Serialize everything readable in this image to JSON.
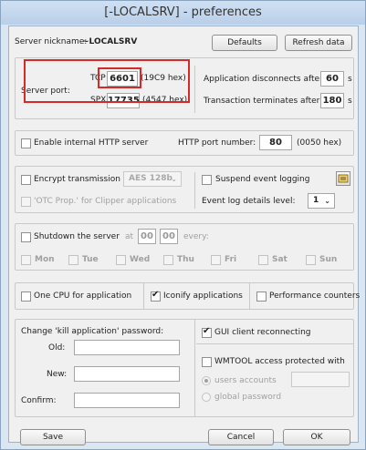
{
  "window": {
    "title": "[-LOCALSRV] - preferences"
  },
  "server": {
    "nickname_label": "Server nickname:",
    "nickname_value": "~LOCALSRV",
    "defaults_btn": "Defaults",
    "refresh_btn": "Refresh data",
    "port_label": "Server port:",
    "tcp_label": "TCP",
    "tcp_value": "6601",
    "tcp_hex": "(19C9 hex)",
    "spx_label": "SPX",
    "spx_value": "17735",
    "spx_hex": "(4547 hex)",
    "app_disc_label": "Application disconnects after",
    "app_disc_value": "60",
    "app_disc_unit": "s",
    "trans_label": "Transaction terminates after",
    "trans_value": "180",
    "trans_unit": "s"
  },
  "http": {
    "enable_label": "Enable internal HTTP server",
    "port_label": "HTTP port number:",
    "port_value": "80",
    "port_hex": "(0050 hex)"
  },
  "encrypt": {
    "label": "Encrypt transmission",
    "cipher": "AES 128b",
    "otc_label": "'OTC Prop.' for Clipper applications",
    "suspend_label": "Suspend event logging",
    "level_label": "Event log details level:",
    "level_value": "1"
  },
  "shutdown": {
    "label": "Shutdown the server",
    "at_label": "at",
    "hour": "00",
    "minute": "00",
    "every_label": "every:",
    "days": [
      "Mon",
      "Tue",
      "Wed",
      "Thu",
      "Fri",
      "Sat",
      "Sun"
    ]
  },
  "options": {
    "one_cpu": "One CPU for application",
    "iconify": "Iconify applications",
    "perf": "Performance counters"
  },
  "password": {
    "title": "Change 'kill application' password:",
    "old_label": "Old:",
    "new_label": "New:",
    "confirm_label": "Confirm:",
    "gui_reconnect": "GUI client reconnecting",
    "wmtool_label": "WMTOOL access protected with",
    "users_label": "users accounts",
    "global_label": "global password"
  },
  "footer": {
    "save": "Save",
    "cancel": "Cancel",
    "ok": "OK"
  },
  "colors": {
    "highlight": "#d42a2a",
    "window_frame": "#b9cfe8"
  }
}
